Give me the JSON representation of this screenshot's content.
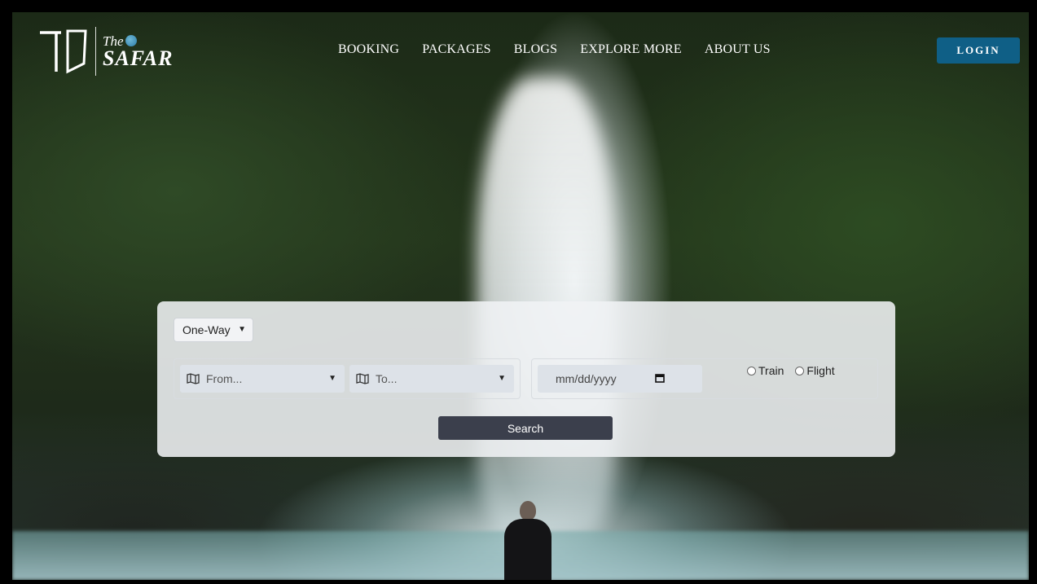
{
  "brand": {
    "the_label": "The",
    "name": "SAFAR",
    "mark_text": "TS"
  },
  "nav": {
    "items": [
      "BOOKING",
      "PACKAGES",
      "BLOGS",
      "EXPLORE MORE",
      "ABOUT US"
    ]
  },
  "header": {
    "login_label": "LOGIN",
    "accent_color": "#0f5f86"
  },
  "search": {
    "trip_type": "One-Way",
    "from_placeholder": "From...",
    "to_placeholder": "To...",
    "date_placeholder": "mm/dd/yyyy",
    "modes": [
      "Train",
      "Flight"
    ],
    "search_label": "Search"
  }
}
